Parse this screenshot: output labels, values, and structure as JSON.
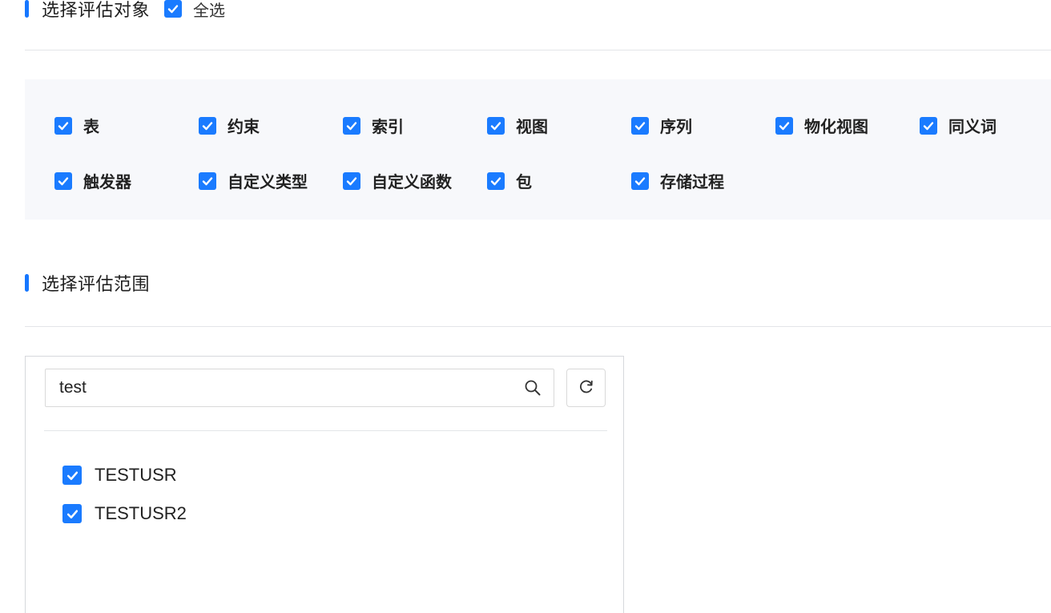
{
  "objects_section": {
    "title": "选择评估对象",
    "select_all_label": "全选",
    "items": [
      {
        "label": "表"
      },
      {
        "label": "约束"
      },
      {
        "label": "索引"
      },
      {
        "label": "视图"
      },
      {
        "label": "序列"
      },
      {
        "label": "物化视图"
      },
      {
        "label": "同义词"
      },
      {
        "label": "触发器"
      },
      {
        "label": "自定义类型"
      },
      {
        "label": "自定义函数"
      },
      {
        "label": "包"
      },
      {
        "label": "存储过程"
      }
    ]
  },
  "scope_section": {
    "title": "选择评估范围",
    "search_value": "test",
    "users": [
      {
        "label": "TESTUSR"
      },
      {
        "label": "TESTUSR2"
      }
    ]
  },
  "colors": {
    "accent": "#1677ff",
    "checkbox": "#1a7bff",
    "panel_bg": "#f7f8fb"
  }
}
